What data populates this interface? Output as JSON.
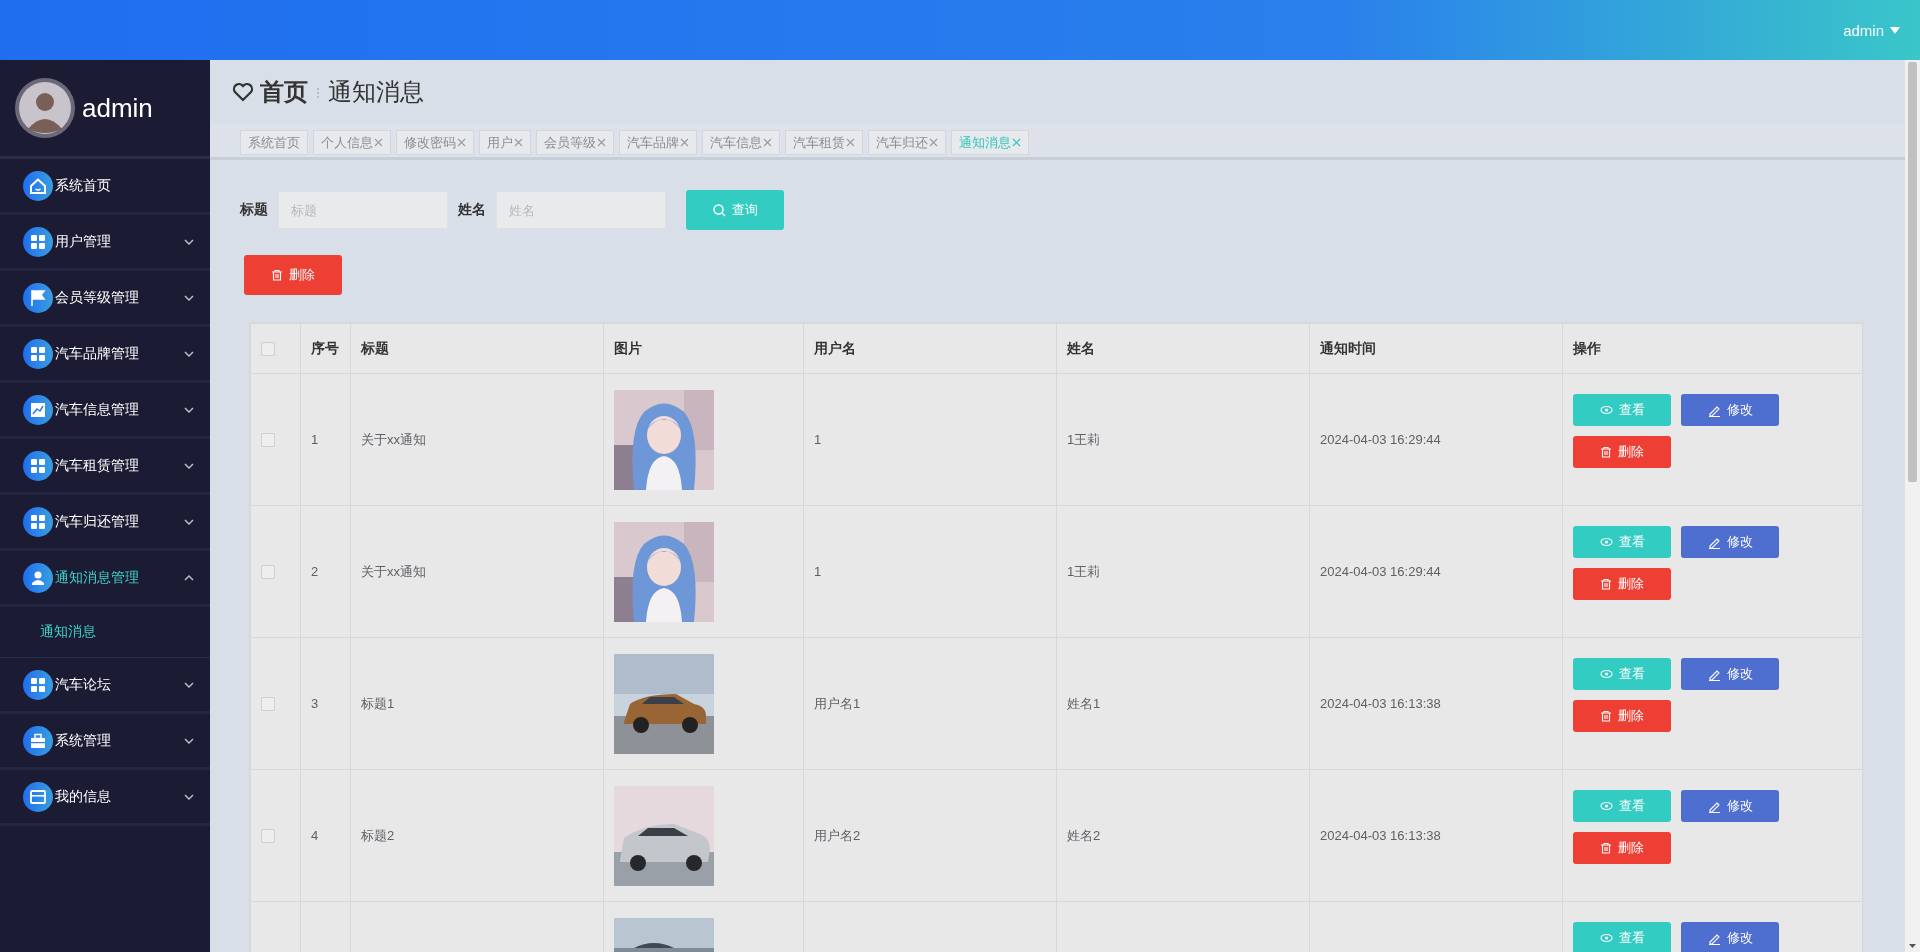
{
  "top_bar": {
    "user": "admin"
  },
  "sidebar": {
    "user": "admin",
    "items": [
      {
        "label": "系统首页",
        "selected": false
      },
      {
        "label": "用户管理",
        "expanded": false,
        "selected": false
      },
      {
        "label": "会员等级管理",
        "expanded": false,
        "selected": false
      },
      {
        "label": "汽车品牌管理",
        "expanded": false,
        "selected": false
      },
      {
        "label": "汽车信息管理",
        "expanded": false,
        "selected": false
      },
      {
        "label": "汽车租赁管理",
        "expanded": false,
        "selected": false
      },
      {
        "label": "汽车归还管理",
        "expanded": false,
        "selected": false
      },
      {
        "label": "通知消息管理",
        "expanded": true,
        "selected": true,
        "children": [
          {
            "label": "通知消息",
            "selected": true
          }
        ]
      },
      {
        "label": "汽车论坛",
        "expanded": false,
        "selected": false
      },
      {
        "label": "系统管理",
        "expanded": false,
        "selected": false
      },
      {
        "label": "我的信息",
        "expanded": false,
        "selected": false
      }
    ]
  },
  "breadcrumb": {
    "home": "首页",
    "current": "通知消息"
  },
  "tabs": [
    {
      "label": "系统首页",
      "closable": false,
      "selected": false
    },
    {
      "label": "个人信息",
      "closable": true,
      "selected": false
    },
    {
      "label": "修改密码",
      "closable": true,
      "selected": false
    },
    {
      "label": "用户",
      "closable": true,
      "selected": false
    },
    {
      "label": "会员等级",
      "closable": true,
      "selected": false
    },
    {
      "label": "汽车品牌",
      "closable": true,
      "selected": false
    },
    {
      "label": "汽车信息",
      "closable": true,
      "selected": false
    },
    {
      "label": "汽车租赁",
      "closable": true,
      "selected": false
    },
    {
      "label": "汽车归还",
      "closable": true,
      "selected": false
    },
    {
      "label": "通知消息",
      "closable": true,
      "selected": true
    }
  ],
  "search": {
    "fields": [
      {
        "label": "标题",
        "placeholder": "标题"
      },
      {
        "label": "姓名",
        "placeholder": "姓名"
      }
    ],
    "button": "查询"
  },
  "toolbar": {
    "delete_button": "删除"
  },
  "table": {
    "all_checked": false,
    "columns": [
      "序号",
      "标题",
      "图片",
      "用户名",
      "姓名",
      "通知时间",
      "操作"
    ],
    "rows": [
      {
        "checked": false,
        "index": "1",
        "title": "关于xx通知",
        "picture": {
          "kind": "picture"
        },
        "username": "1",
        "name": "1王莉",
        "time": "2024-04-03 16:29:44",
        "actions": [
          {
            "kind": "view",
            "label": "查看"
          },
          {
            "kind": "edit",
            "label": "修改"
          },
          {
            "kind": "delete",
            "label": "删除"
          }
        ]
      },
      {
        "checked": false,
        "index": "2",
        "title": "关于xx通知",
        "picture": {
          "kind": "picture"
        },
        "username": "1",
        "name": "1王莉",
        "time": "2024-04-03 16:29:44",
        "actions": [
          {
            "kind": "view",
            "label": "查看"
          },
          {
            "kind": "edit",
            "label": "修改"
          },
          {
            "kind": "delete",
            "label": "删除"
          }
        ]
      },
      {
        "checked": false,
        "index": "3",
        "title": "标题1",
        "picture": {
          "kind": "picture"
        },
        "username": "用户名1",
        "name": "姓名1",
        "time": "2024-04-03 16:13:38",
        "actions": [
          {
            "kind": "view",
            "label": "查看"
          },
          {
            "kind": "edit",
            "label": "修改"
          },
          {
            "kind": "delete",
            "label": "删除"
          }
        ]
      },
      {
        "checked": false,
        "index": "4",
        "title": "标题2",
        "picture": {
          "kind": "picture"
        },
        "username": "用户名2",
        "name": "姓名2",
        "time": "2024-04-03 16:13:38",
        "actions": [
          {
            "kind": "view",
            "label": "查看"
          },
          {
            "kind": "edit",
            "label": "修改"
          },
          {
            "kind": "delete",
            "label": "删除"
          }
        ]
      },
      {
        "picture": {
          "kind": "picture"
        },
        "actions": [
          {
            "kind": "view",
            "label": "查看"
          },
          {
            "kind": "edit",
            "label": "修改"
          }
        ]
      }
    ]
  }
}
